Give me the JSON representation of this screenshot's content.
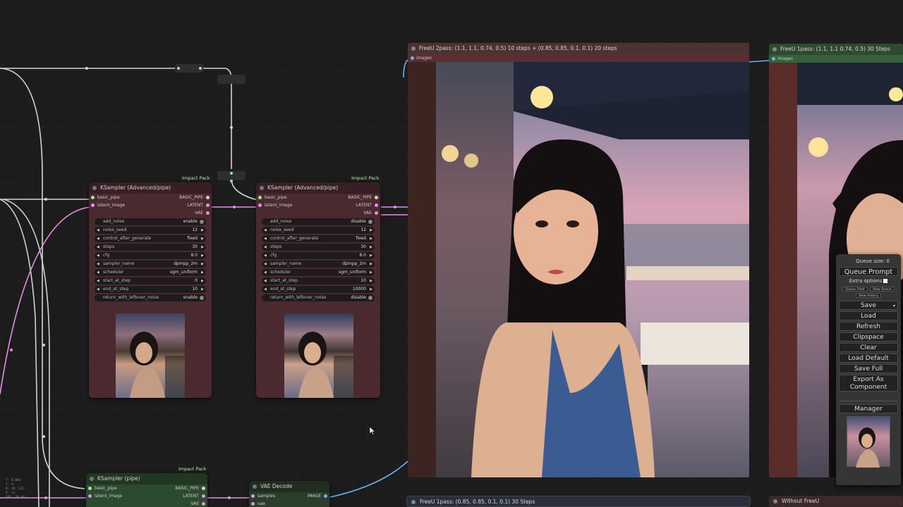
{
  "colors": {
    "canvas_bg": "#1d1d1d",
    "ksampler_node": "#4a2a2f",
    "pipe_node": "#2c4a2d",
    "link_white": "#cfd6cf",
    "link_pink": "#e88de8",
    "link_blue": "#64b5f6",
    "badge_green": "#b9f0a0"
  },
  "ksampler1": {
    "title": "KSampler (Advanced/pipe)",
    "badge": "Impact Pack",
    "inputs": [
      "basic_pipe",
      "latent_image"
    ],
    "outputs": [
      "BASIC_PIPE",
      "LATENT",
      "VAE"
    ],
    "widgets": [
      {
        "label": "add_noise",
        "value": "enable",
        "kind": "toggle"
      },
      {
        "label": "noise_seed",
        "value": "12",
        "kind": "number"
      },
      {
        "label": "control_after_generate",
        "value": "fixed",
        "kind": "combo"
      },
      {
        "label": "steps",
        "value": "30",
        "kind": "number"
      },
      {
        "label": "cfg",
        "value": "8.0",
        "kind": "number"
      },
      {
        "label": "sampler_name",
        "value": "dpmpp_2m",
        "kind": "combo"
      },
      {
        "label": "scheduler",
        "value": "sgm_uniform",
        "kind": "combo"
      },
      {
        "label": "start_at_step",
        "value": "0",
        "kind": "number"
      },
      {
        "label": "end_at_step",
        "value": "10",
        "kind": "number"
      },
      {
        "label": "return_with_leftover_noise",
        "value": "enable",
        "kind": "toggle"
      }
    ]
  },
  "ksampler2": {
    "title": "KSampler (Advanced/pipe)",
    "badge": "Impact Pack",
    "inputs": [
      "basic_pipe",
      "latent_image"
    ],
    "outputs": [
      "BASIC_PIPE",
      "LATENT",
      "VAE"
    ],
    "widgets": [
      {
        "label": "add_noise",
        "value": "disable",
        "kind": "toggle"
      },
      {
        "label": "noise_seed",
        "value": "12",
        "kind": "number"
      },
      {
        "label": "control_after_generate",
        "value": "fixed",
        "kind": "combo"
      },
      {
        "label": "steps",
        "value": "30",
        "kind": "number"
      },
      {
        "label": "cfg",
        "value": "8.0",
        "kind": "number"
      },
      {
        "label": "sampler_name",
        "value": "dpmpp_2m",
        "kind": "combo"
      },
      {
        "label": "scheduler",
        "value": "sgm_uniform",
        "kind": "combo"
      },
      {
        "label": "start_at_step",
        "value": "10",
        "kind": "number"
      },
      {
        "label": "end_at_step",
        "value": "10000",
        "kind": "number"
      },
      {
        "label": "return_with_leftover_noise",
        "value": "disable",
        "kind": "toggle"
      }
    ]
  },
  "ksampler_pipe": {
    "title": "KSampler (pipe)",
    "badge": "Impact Pack",
    "inputs": [
      "basic_pipe",
      "latent_image"
    ],
    "outputs": [
      "BASIC_PIPE",
      "LATENT",
      "VAE"
    ]
  },
  "vae_decode": {
    "title": "VAE Decode",
    "inputs": [
      "samples",
      "vae"
    ],
    "outputs": [
      "IMAGE"
    ]
  },
  "viewer_main": {
    "title": "FreeU 2pass: (1.1, 1.1, 0.74, 0.5) 10 steps + (0.85, 0.85, 0.1, 0.1) 20 steps",
    "input": "images"
  },
  "viewer_right": {
    "title": "FreeU 1pass: (1.1, 1.1 0.74, 0.5) 30 Steps",
    "input": "images"
  },
  "bottom_bars": {
    "left": "FreeU 1pass: (0.85, 0.85, 0.1, 0.1) 30 Steps",
    "right": "Without FreeU"
  },
  "queue_panel": {
    "queue_size": "Queue size: 0",
    "queue_prompt": "Queue Prompt",
    "extra_options": "Extra options",
    "queue_front": "Queue Front",
    "view_queue": "View Queue",
    "view_history": "View History",
    "save": "Save",
    "load": "Load",
    "refresh": "Refresh",
    "clipspace": "Clipspace",
    "clear": "Clear",
    "load_default": "Load Default",
    "save_full": "Save Full",
    "export_as_component": "Export As Component",
    "manager": "Manager"
  },
  "canvas_info": [
    "T: 0.00s",
    "I: 0",
    "N: 26 [12]",
    "V: 31",
    "FPS: 30.00"
  ]
}
